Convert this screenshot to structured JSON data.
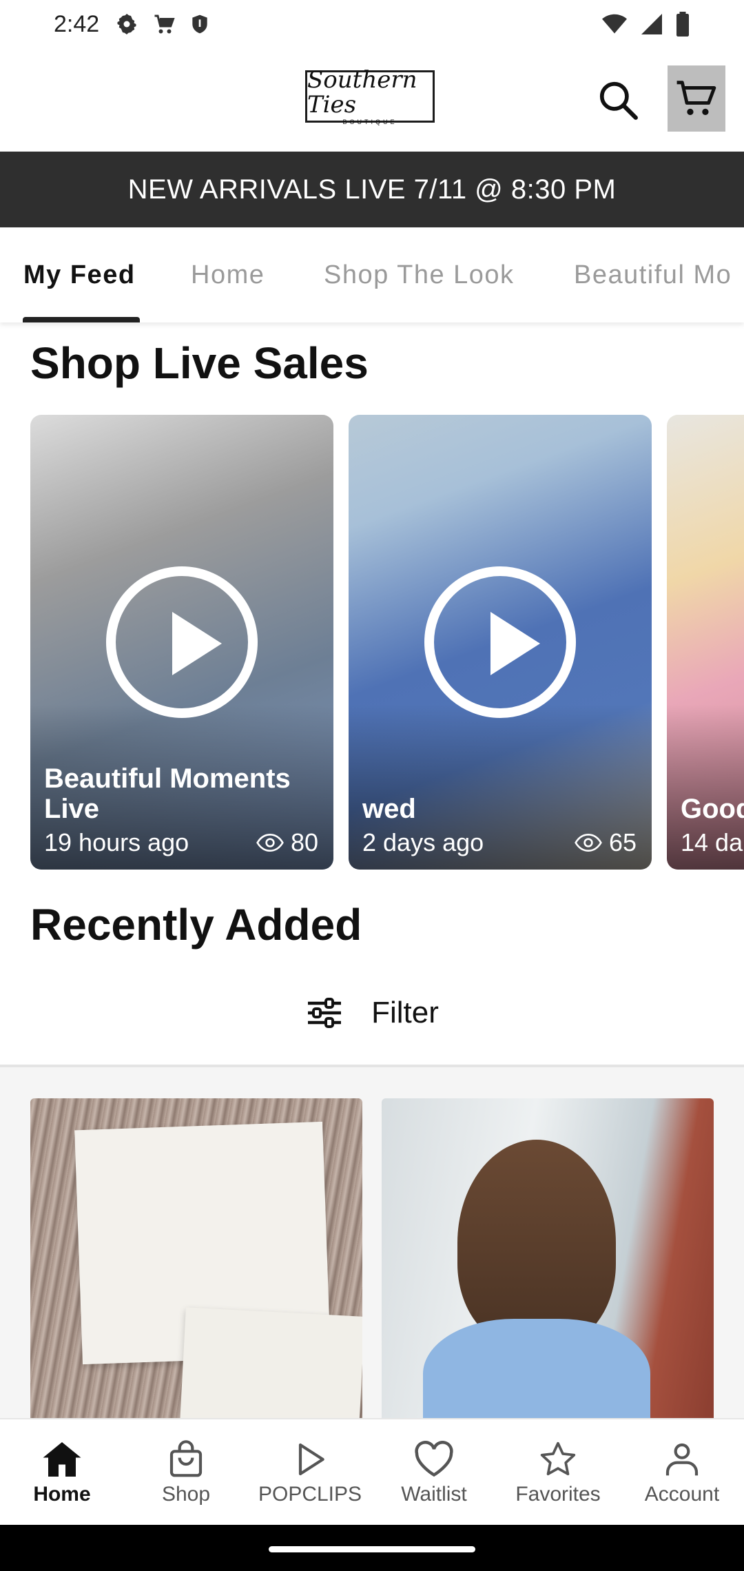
{
  "status_bar": {
    "time": "2:42",
    "icons_left": [
      "settings-icon",
      "cart-notification-icon",
      "shield-icon"
    ],
    "icons_right": [
      "wifi-icon",
      "signal-icon",
      "battery-icon"
    ]
  },
  "header": {
    "logo_main": "Southern Ties",
    "logo_sub": "BOUTIQUE",
    "search_icon": "search-icon",
    "cart_icon": "cart-icon"
  },
  "announcement": "NEW ARRIVALS LIVE 7/11 @ 8:30 PM",
  "tabs": [
    {
      "label": "My Feed",
      "active": true
    },
    {
      "label": "Home",
      "active": false
    },
    {
      "label": "Shop The Look",
      "active": false
    },
    {
      "label": "Beautiful Mo",
      "active": false
    }
  ],
  "live_section": {
    "title": "Shop Live Sales",
    "cards": [
      {
        "title": "Beautiful Moments Live",
        "time": "19 hours ago",
        "views": "80"
      },
      {
        "title": "wed",
        "time": "2 days ago",
        "views": "65"
      },
      {
        "title": "Good Live",
        "time": "14 da",
        "views": ""
      }
    ]
  },
  "recent_section": {
    "title": "Recently Added",
    "filter_label": "Filter"
  },
  "bottom_nav": [
    {
      "label": "Home",
      "icon": "home-icon",
      "active": true
    },
    {
      "label": "Shop",
      "icon": "shopping-bag-icon",
      "active": false
    },
    {
      "label": "POPCLIPS",
      "icon": "play-icon",
      "active": false
    },
    {
      "label": "Waitlist",
      "icon": "heart-icon",
      "active": false
    },
    {
      "label": "Favorites",
      "icon": "star-icon",
      "active": false
    },
    {
      "label": "Account",
      "icon": "person-icon",
      "active": false
    }
  ],
  "colors": {
    "announcement_bg": "#2f2f2f",
    "cart_button_bg": "#bdbdbd",
    "tab_inactive": "#9a9a9a",
    "text_primary": "#111111"
  }
}
